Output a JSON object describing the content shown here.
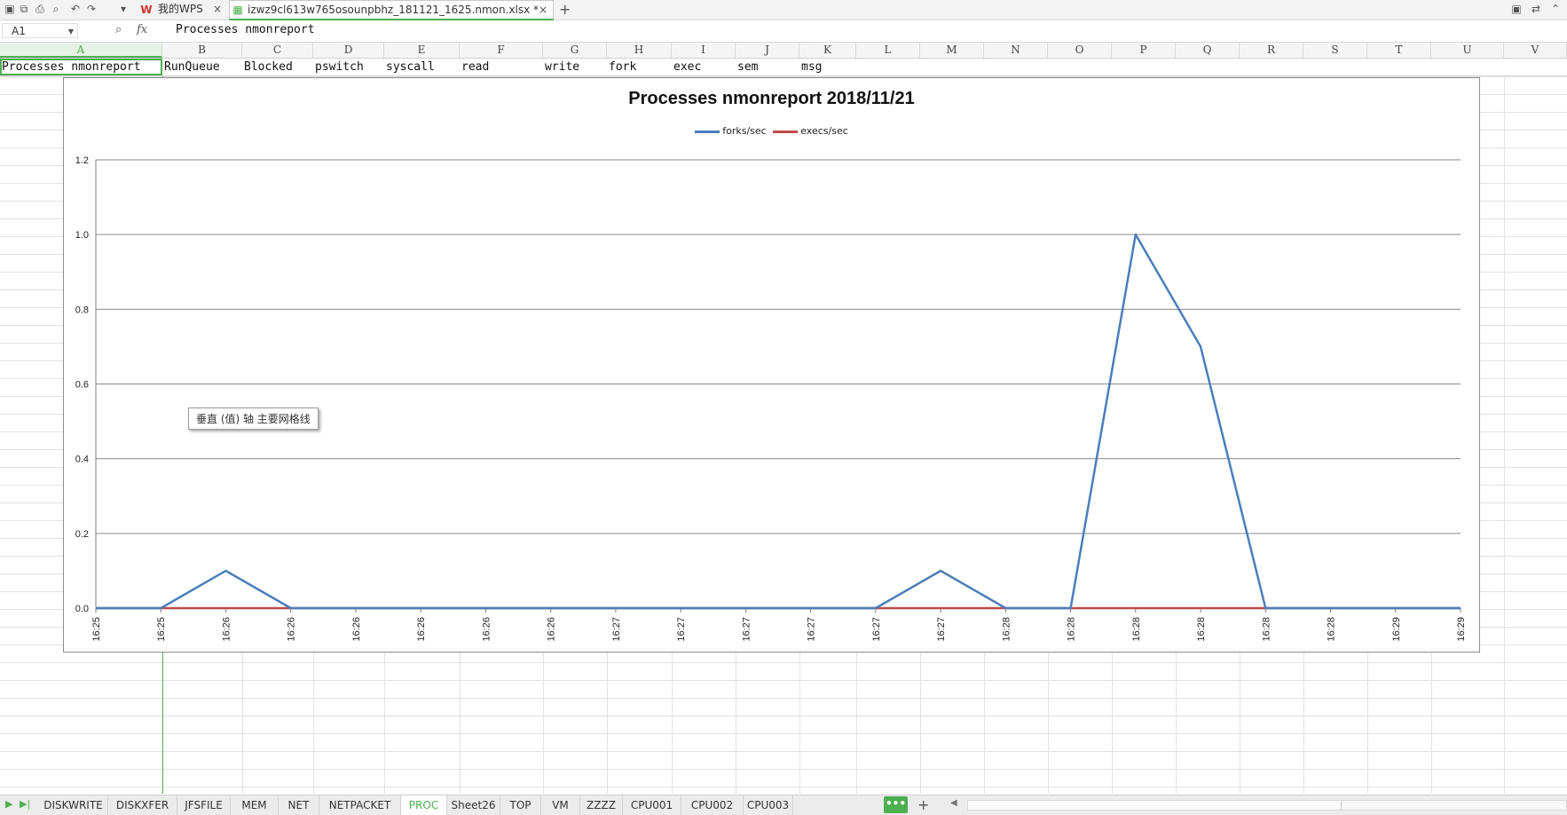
{
  "titlebar": {
    "tabs": [
      {
        "label": "我的WPS",
        "close": "×"
      },
      {
        "label": "izwz9cl613w765osounpbhz_181121_1625.nmon.xlsx *",
        "close": "×"
      }
    ],
    "add_tab": "+"
  },
  "formula_bar": {
    "name_box": "A1",
    "fx": "fx",
    "content": "Processes nmonreport"
  },
  "columns": [
    "A",
    "B",
    "C",
    "D",
    "E",
    "F",
    "G",
    "H",
    "I",
    "J",
    "K",
    "L",
    "M",
    "N",
    "O",
    "P",
    "Q",
    "R",
    "S",
    "T",
    "U",
    "V"
  ],
  "row1": [
    "Processes nmonreport",
    "RunQueue",
    "Blocked",
    "pswitch",
    "syscall",
    "read",
    "write",
    "fork",
    "exec",
    "sem",
    "msg"
  ],
  "tooltip": "垂直 (值) 轴 主要网格线",
  "chart_data": {
    "type": "line",
    "title": "Processes nmonreport  2018/11/21",
    "categories": [
      "16:25",
      "16:25",
      "16:26",
      "16:26",
      "16:26",
      "16:26",
      "16:26",
      "16:26",
      "16:27",
      "16:27",
      "16:27",
      "16:27",
      "16:27",
      "16:27",
      "16:28",
      "16:28",
      "16:28",
      "16:28",
      "16:28",
      "16:28",
      "16:29",
      "16:29"
    ],
    "series": [
      {
        "name": "forks/sec",
        "color": "#4a7ebb",
        "values": [
          0,
          0,
          0.1,
          0,
          0,
          0,
          0,
          0,
          0,
          0,
          0,
          0,
          0,
          0.1,
          0,
          0,
          1.0,
          0.7,
          0,
          0,
          0,
          0
        ]
      },
      {
        "name": "execs/sec",
        "color": "#be4b48",
        "values": [
          0,
          0,
          0,
          0,
          0,
          0,
          0,
          0,
          0,
          0,
          0,
          0,
          0,
          0,
          0,
          0,
          0,
          0,
          0,
          0,
          0,
          0
        ]
      }
    ],
    "yticks": [
      "0.0",
      "0.2",
      "0.4",
      "0.6",
      "0.8",
      "1.0",
      "1.2"
    ],
    "ylim": [
      0,
      1.2
    ],
    "grid": true,
    "legend": "top"
  },
  "sheet_tabs": [
    "DISKWRITE",
    "DISKXFER",
    "JFSFILE",
    "MEM",
    "NET",
    "NETPACKET",
    "PROC",
    "Sheet26",
    "TOP",
    "VM",
    "ZZZZ",
    "CPU001",
    "CPU002",
    "CPU003"
  ],
  "active_sheet": "PROC",
  "more_label": "•••",
  "add_sheet": "+"
}
